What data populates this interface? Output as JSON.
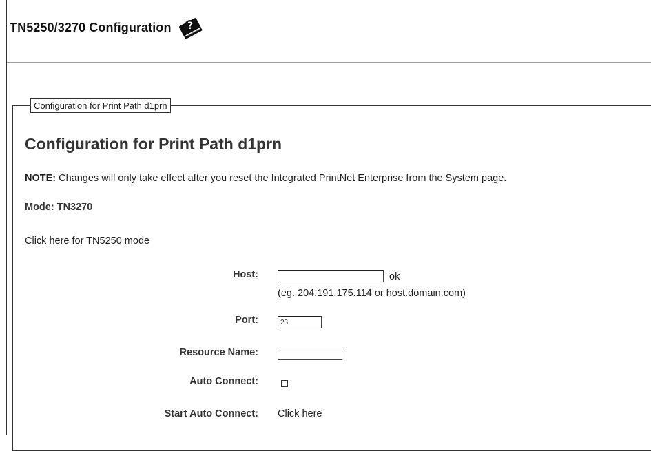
{
  "header": {
    "title": "TN5250/3270 Configuration",
    "help_icon": "help-book-icon"
  },
  "section": {
    "legend": "Configuration for Print Path d1prn",
    "title": "Configuration for Print Path d1prn",
    "note_label": "NOTE:",
    "note_text": " Changes will only take effect after you reset the Integrated PrintNet Enterprise from the System page.",
    "mode_text": "Mode: TN3270",
    "mode_link": "Click here for TN5250 mode"
  },
  "form": {
    "host": {
      "label": "Host:",
      "value": "",
      "status": "ok",
      "hint": "(eg. 204.191.175.114 or host.domain.com)"
    },
    "port": {
      "label": "Port:",
      "value": "23"
    },
    "resource_name": {
      "label": "Resource Name:",
      "value": ""
    },
    "auto_connect": {
      "label": "Auto Connect:",
      "checked": false
    },
    "start_auto_connect": {
      "label": "Start Auto Connect:",
      "link": "Click here"
    }
  }
}
